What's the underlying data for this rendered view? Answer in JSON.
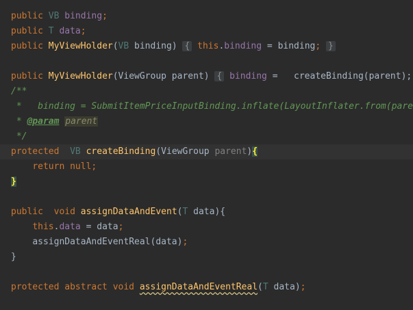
{
  "code": {
    "l1": {
      "kw": "public",
      "type": "VB",
      "field": "binding",
      "semi": ";"
    },
    "l2": {
      "kw": "public",
      "type": "T",
      "field": "data",
      "semi": ";"
    },
    "l3": {
      "kw": "public",
      "name": "MyViewHolder",
      "open": "(",
      "ptype": "VB",
      "param": "binding",
      "close": ")",
      "lbrace": "{",
      "this": "this",
      "dot": ".",
      "field": "binding",
      "eq": "=",
      "arg": "binding",
      "semi": ";",
      "rbrace": "}"
    },
    "l5": {
      "kw": "public",
      "name": "MyViewHolder",
      "params": "(ViewGroup parent)",
      "lbrace": "{",
      "field": "binding",
      "eq": "=",
      "call": "createBinding(parent);",
      "rbrace": "}"
    },
    "l6": {
      "text": "/**"
    },
    "l7": {
      "text": " *   binding = SubmitItemPriceInputBinding.inflate(LayoutInflater.from(parent.getContext()), parent, false);"
    },
    "l8": {
      "prefix": " * ",
      "tag": "@param",
      "param": "parent"
    },
    "l9": {
      "text": " */"
    },
    "l10": {
      "kw": "protected",
      "type": "VB",
      "name": "createBinding",
      "params_open": "(ViewGroup ",
      "param": "parent",
      "params_close": ")",
      "brace": "{"
    },
    "l11": {
      "kw": "return",
      "val": "null",
      "semi": ";"
    },
    "l12": {
      "brace": "}"
    },
    "l14": {
      "kw1": "public",
      "kw2": "void",
      "name": "assignDataAndEvent",
      "open": "(",
      "ptype": "T",
      "rest": " data){"
    },
    "l15": {
      "this": "this",
      "dot": ".",
      "field": "data",
      "rest": " = data",
      "semi": ";"
    },
    "l16": {
      "text": "assignDataAndEventReal(data)",
      "semi": ";"
    },
    "l17": {
      "brace": "}"
    },
    "l19": {
      "kw": "protected abstract void",
      "name": "assignDataAndEventReal",
      "open": "(",
      "ptype": "T",
      "rest": " data)",
      "semi": ";"
    }
  },
  "colors": {
    "background": "#2b2b2b",
    "keyword": "#cc7832",
    "type_param": "#507874",
    "field": "#9876aa",
    "method": "#ffc66d",
    "comment": "#629755",
    "text": "#a9b7c6"
  }
}
